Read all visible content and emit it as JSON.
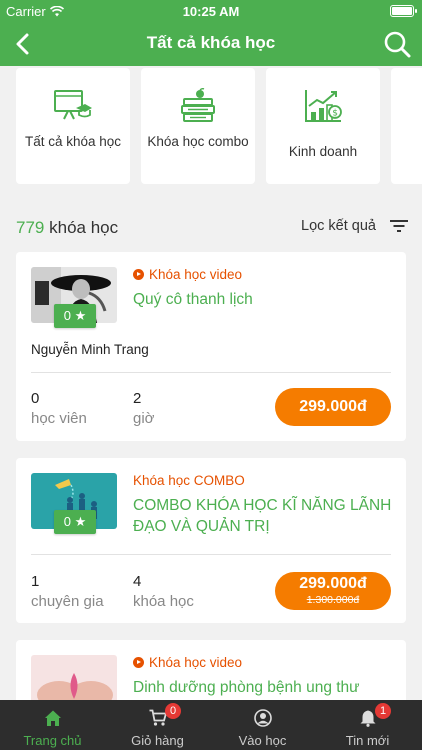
{
  "status_bar": {
    "carrier": "Carrier",
    "time": "10:25 AM"
  },
  "nav": {
    "title": "Tất cả khóa học"
  },
  "categories": [
    {
      "label": "Tất cả khóa học",
      "icon": "presentation-board-icon"
    },
    {
      "label": "Khóa học combo",
      "icon": "book-stack-icon"
    },
    {
      "label": "Kinh doanh",
      "icon": "growth-chart-icon"
    }
  ],
  "summary": {
    "count": "779",
    "count_label": "khóa học",
    "filter_label": "Lọc kết quả"
  },
  "courses": [
    {
      "type": "Khóa học video",
      "title": "Quý cô thanh lịch",
      "rating": "0",
      "author": "Nguyễn Minh Trang",
      "stat1_value": "0",
      "stat1_label": "học viên",
      "stat2_value": "2",
      "stat2_label": "giờ",
      "price": "299.000đ"
    },
    {
      "type": "Khóa học COMBO",
      "title": "COMBO KHÓA HỌC KĨ NĂNG LÃNH ĐẠO VÀ QUẢN TRỊ",
      "rating": "0",
      "stat1_value": "1",
      "stat1_label": "chuyên gia",
      "stat2_value": "4",
      "stat2_label": "khóa học",
      "price": "299.000đ",
      "old_price": "1.300.000đ"
    },
    {
      "type": "Khóa học video",
      "title": "Dinh dưỡng phòng bệnh ung thư"
    }
  ],
  "tabs": [
    {
      "label": "Trang chủ",
      "icon": "home-icon"
    },
    {
      "label": "Giỏ hàng",
      "icon": "cart-icon",
      "badge": "0"
    },
    {
      "label": "Vào học",
      "icon": "user-icon"
    },
    {
      "label": "Tin mới",
      "icon": "bell-icon",
      "badge": "1"
    }
  ],
  "colors": {
    "primary": "#4caf50",
    "accent": "#f57c00",
    "type_label": "#e65100",
    "tabbar": "#2d2d2d"
  }
}
